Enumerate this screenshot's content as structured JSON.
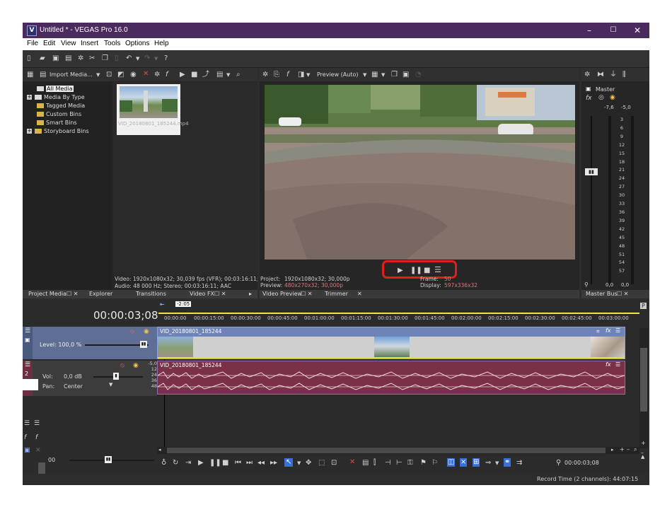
{
  "window": {
    "logo": "V",
    "title": "Untitled * - VEGAS Pro 16.0",
    "minimize": "–",
    "maximize": "☐",
    "close": "✕"
  },
  "menu": [
    "File",
    "Edit",
    "View",
    "Insert",
    "Tools",
    "Options",
    "Help"
  ],
  "media_panel": {
    "import_label": "Import Media...",
    "tree": [
      {
        "label": "All Media",
        "selected": true
      },
      {
        "label": "Media By Type",
        "expandable": true
      },
      {
        "label": "Tagged Media"
      },
      {
        "label": "Custom Bins"
      },
      {
        "label": "Smart Bins"
      },
      {
        "label": "Storyboard Bins",
        "expandable": true
      }
    ],
    "thumb_caption": "VID_20180801_185244.mp4",
    "info_video": "Video: 1920x1080x32; 30,039 fps (VFR); 00:03:16:11; A",
    "info_audio": "Audio: 48 000 Hz; Stereo; 00:03:16:11; AAC",
    "tabs": [
      "Project Media",
      "Explorer",
      "Transitions",
      "Video FX"
    ]
  },
  "preview_panel": {
    "mode": "Preview (Auto)",
    "project_label": "Project:",
    "project_value": "1920x1080x32; 30,000p",
    "preview_label": "Preview:",
    "preview_value": "480x270x32; 30,000p",
    "frame_label": "Frame:",
    "frame_value": "50",
    "display_label": "Display:",
    "display_value": "597x336x32",
    "tabs": [
      "Video Preview",
      "Trimmer"
    ]
  },
  "master_panel": {
    "title": "Master",
    "left_level": "-7,6",
    "right_level": "-5,0",
    "scale": [
      "3",
      "6",
      "9",
      "12",
      "15",
      "18",
      "21",
      "24",
      "27",
      "30",
      "33",
      "36",
      "39",
      "42",
      "45",
      "48",
      "51",
      "54",
      "57"
    ],
    "bottom_left": "0,0",
    "bottom_right": "0,0",
    "tab": "Master Bus"
  },
  "timeline": {
    "timecode": "00:00:03;08",
    "marker": "-2:05",
    "ruler": [
      "00:00:00",
      "00:00:15:00",
      "00:00:30:00",
      "00:00:45:00",
      "00:01:00:00",
      "00:01:15:00",
      "00:01:30:00",
      "00:01:45:00",
      "00:02:00:00",
      "00:02:15:00",
      "00:02:30:00",
      "00:02:45:00",
      "00:03:00:00"
    ],
    "video_track": {
      "level": "Level: 100,0 %",
      "event": "VID_20180801_185244"
    },
    "audio_track": {
      "number": "2",
      "vol_label": "Vol:",
      "vol_value": "0,0 dB",
      "pan_label": "Pan:",
      "pan_value": "Center",
      "event": "VID_20180801_185244"
    },
    "audio_scale": [
      "-5,0",
      "12",
      "24",
      "36",
      "48"
    ],
    "left_zoom": "00",
    "transport_time": "00:00:03;08"
  },
  "status": {
    "record_time": "Record Time (2 channels): 44:07:15"
  },
  "colors": {
    "title_bar": "#4b2a5e",
    "highlight_ring": "#e21d1d",
    "video_event": "#6e83b8",
    "audio_event": "#7a3046"
  }
}
